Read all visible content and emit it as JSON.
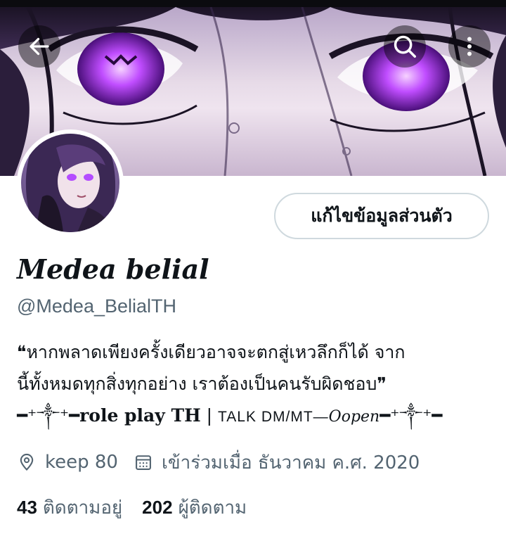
{
  "header": {
    "back_icon": "arrow-left-icon",
    "search_icon": "search-icon",
    "more_icon": "more-vertical-icon"
  },
  "profile": {
    "edit_button_label": "แก้ไขข้อมูลส่วนตัว",
    "display_name": "Medea belial",
    "handle": "@Medea_BelialTH",
    "bio": {
      "line1": "❝หากพลาดเพียงครั้งเดียวอาจจะตกสู่เหวลึกก็ได้ จาก",
      "line2": "นี้ทั้งหมดทุกสิ่งทุกอย่าง เราต้องเป็นคนรับผิดชอบ❞",
      "line3_start": "━⁺༒⁺━",
      "line3_role": "role play TH",
      "line3_sep": " | ",
      "line3_talk": "TALK DM/MT—",
      "line3_open": "Oopen",
      "line3_end": "━⁺༒⁺━"
    },
    "location": "keep 80",
    "joined": "เข้าร่วมเมื่อ ธันวาคม ค.ศ. 2020",
    "following_count": "43",
    "following_label": "ติดตามอยู่",
    "followers_count": "202",
    "followers_label": "ผู้ติดตาม"
  },
  "colors": {
    "text_primary": "#0f1419",
    "text_secondary": "#536471",
    "border": "#cfd9de",
    "eye_glow": "#c04dff"
  }
}
